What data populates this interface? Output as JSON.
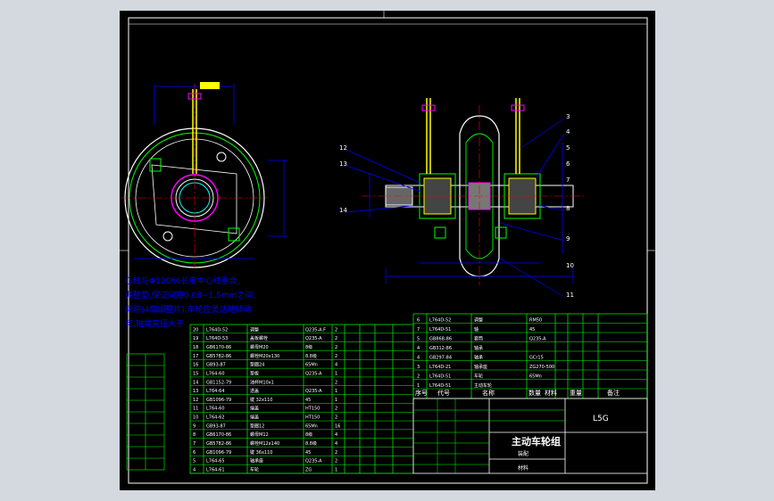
{
  "drawing": {
    "title_block": {
      "title": "主动车轮组",
      "code": "L5G",
      "sub": "装配",
      "footer": "材料"
    },
    "notes": [
      "心线与Φ120h6长度中心线重合,",
      "调整垫,保证间隙0.08~1.5mm之间,",
      "间隙(4個調整片),车轮应灵活地转动",
      "可,轴端直径大于"
    ],
    "part_labels_right": [
      "3",
      "4",
      "5",
      "6",
      "7",
      "8",
      "9",
      "10",
      "11"
    ],
    "part_labels_left": [
      "12",
      "13",
      "14"
    ],
    "bom_rows": [
      {
        "no": "20",
        "code": "L764D-52",
        "name": "调整",
        "qty": "2",
        "mat": "Q235-A.F"
      },
      {
        "no": "19",
        "code": "L764D-53",
        "name": "盖板螺栓",
        "qty": "2",
        "mat": "Q235-A"
      },
      {
        "no": "18",
        "code": "GB6170-86",
        "name": "螺母M20",
        "qty": "2",
        "mat": "8级"
      },
      {
        "no": "17",
        "code": "GB5782-86",
        "name": "螺栓M20x130",
        "qty": "2",
        "mat": "8.8级"
      },
      {
        "no": "16",
        "code": "GB93-87",
        "name": "垫圈24",
        "qty": "4",
        "mat": "65Mn"
      },
      {
        "no": "15",
        "code": "L764-60",
        "name": "垫板",
        "qty": "1",
        "mat": "Q235-A"
      },
      {
        "no": "14",
        "code": "GB1152-79",
        "name": "油杯M10x1",
        "qty": "2",
        "mat": ""
      },
      {
        "no": "13",
        "code": "L764-64",
        "name": "透盖",
        "qty": "1",
        "mat": "Q235-A"
      },
      {
        "no": "12",
        "code": "GB1096-79",
        "name": "键 32x110",
        "qty": "1",
        "mat": "45"
      },
      {
        "no": "11",
        "code": "L764-60",
        "name": "端盖",
        "qty": "2",
        "mat": "HT150"
      },
      {
        "no": "10",
        "code": "L764-62",
        "name": "端盖",
        "qty": "2",
        "mat": "HT150"
      },
      {
        "no": "9",
        "code": "GB93-87",
        "name": "垫圈12",
        "qty": "16",
        "mat": "65Mn"
      },
      {
        "no": "8",
        "code": "GB6170-86",
        "name": "螺母M12",
        "qty": "4",
        "mat": "8级"
      },
      {
        "no": "7",
        "code": "GB5782-86",
        "name": "螺栓M12x140",
        "qty": "4",
        "mat": "8.8级"
      },
      {
        "no": "6",
        "code": "GB1096-79",
        "name": "键 36x110",
        "qty": "2",
        "mat": "45"
      },
      {
        "no": "5",
        "code": "L764-65",
        "name": "轴承座",
        "qty": "2",
        "mat": "Q235-A"
      },
      {
        "no": "4",
        "code": "L764-61",
        "name": "车轮",
        "qty": "1",
        "mat": "ZG"
      }
    ],
    "bom_rows_right": [
      {
        "no": "6",
        "code": "L764D-52",
        "name": "调整",
        "mat": "RM50"
      },
      {
        "no": "7",
        "code": "L764D-51",
        "name": "轴",
        "mat": "45"
      },
      {
        "no": "5",
        "code": "GB868-86",
        "name": "套筒",
        "mat": "Q235-A"
      },
      {
        "no": "4",
        "code": "GB312-86",
        "name": "轴承",
        "mat": ""
      },
      {
        "no": "4",
        "code": "GB297-84",
        "name": "轴承",
        "mat": "GCr15"
      },
      {
        "no": "3",
        "code": "L764D-21",
        "name": "轴承座",
        "mat": "ZG270-500"
      },
      {
        "no": "2",
        "code": "L764D-51",
        "name": "车轮",
        "mat": "65Mn"
      },
      {
        "no": "1",
        "code": "L764D-51",
        "name": "主动车轮",
        "mat": ""
      }
    ],
    "header_labels": [
      "序号",
      "代号",
      "名称",
      "数量",
      "材料",
      "重量",
      "备注"
    ]
  }
}
